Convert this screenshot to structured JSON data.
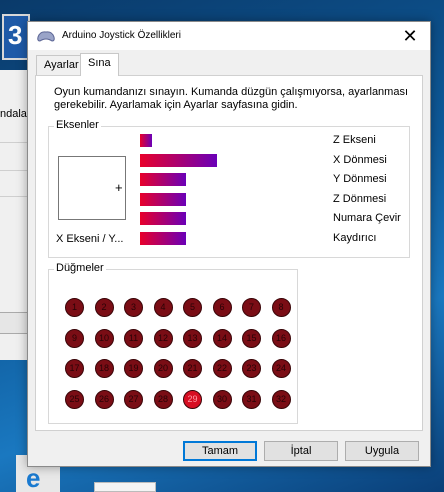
{
  "background": {
    "left_snippet": "ndala",
    "app_icon_letter": "3"
  },
  "dialog": {
    "title": "Arduino Joystick Özellikleri",
    "close_glyph": "✕",
    "tabs": [
      {
        "label": "Ayarlar",
        "active": false
      },
      {
        "label": "Sına",
        "active": true
      }
    ],
    "intro": "Oyun kumandanızı sınayın. Kumanda düzgün çalışmıyorsa, ayarlanması gerekebilir. Ayarlamak için Ayarlar sayfasına gidin.",
    "axes": {
      "label": "Eksenler",
      "xy_label": "X Ekseni / Y...",
      "crosshair_glyph": "+",
      "rows": [
        {
          "label": "Z Ekseni",
          "level": 0.15
        },
        {
          "label": "X Dönmesi",
          "level": 1.0
        },
        {
          "label": "Y Dönmesi",
          "level": 0.6
        },
        {
          "label": "Z Dönmesi",
          "level": 0.6
        },
        {
          "label": "Numara Çevir",
          "level": 0.6
        },
        {
          "label": "Kaydırıcı",
          "level": 0.6
        }
      ]
    },
    "buttons": {
      "label": "Düğmeler",
      "items": [
        "1",
        "2",
        "3",
        "4",
        "5",
        "6",
        "7",
        "8",
        "9",
        "10",
        "11",
        "12",
        "13",
        "14",
        "15",
        "16",
        "17",
        "18",
        "19",
        "20",
        "21",
        "22",
        "23",
        "24",
        "25",
        "26",
        "27",
        "28",
        "29",
        "30",
        "31",
        "32"
      ],
      "pressed": [
        "29"
      ]
    },
    "footer": {
      "ok": "Tamam",
      "cancel": "İptal",
      "apply": "Uygula"
    },
    "colors": {
      "bar_start": "#e8002a",
      "bar_end": "#6a00b8",
      "button_idle": "#7a0d15",
      "button_pressed": "#d70e22"
    }
  }
}
